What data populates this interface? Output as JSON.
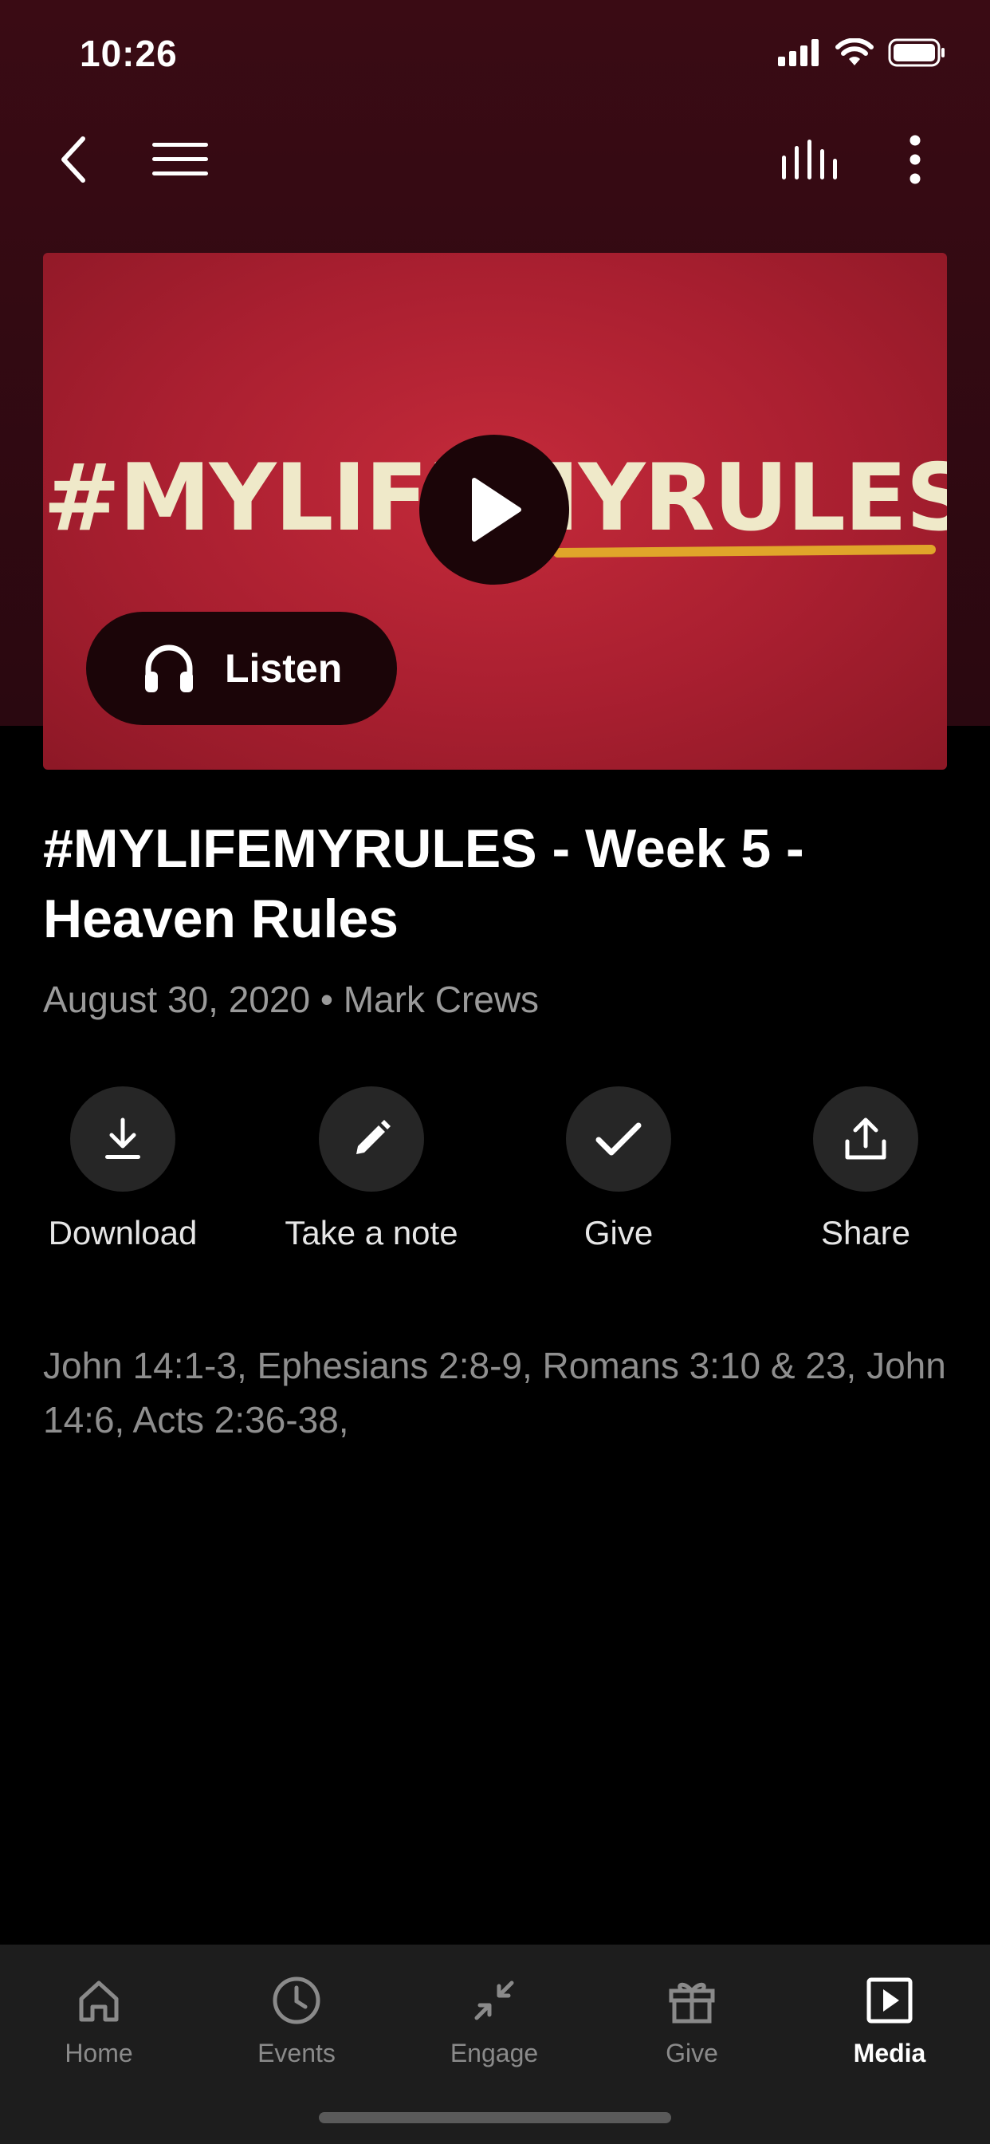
{
  "status_bar": {
    "time": "10:26"
  },
  "hero": {
    "artwork_text": "#MYLIFEMYRULES",
    "listen_label": "Listen"
  },
  "sermon": {
    "title": "#MYLIFEMYRULES - Week 5 - Heaven Rules",
    "meta": "August 30, 2020 • Mark Crews",
    "scripture": "John 14:1-3, Ephesians 2:8-9, Romans 3:10 & 23, John 14:6, Acts 2:36-38,"
  },
  "actions": [
    {
      "label": "Download",
      "icon": "download-icon"
    },
    {
      "label": "Take a note",
      "icon": "pencil-icon"
    },
    {
      "label": "Give",
      "icon": "checkmark-icon"
    },
    {
      "label": "Share",
      "icon": "share-icon"
    }
  ],
  "tabbar": {
    "tabs": [
      {
        "label": "Home",
        "icon": "home-icon"
      },
      {
        "label": "Events",
        "icon": "clock-icon"
      },
      {
        "label": "Engage",
        "icon": "engage-arrows-icon"
      },
      {
        "label": "Give",
        "icon": "gift-icon"
      },
      {
        "label": "Media",
        "icon": "play-square-icon",
        "active": true
      }
    ]
  },
  "colors": {
    "header_bg": "#3a0b14",
    "hero_red": "#b02232",
    "accent_yellow": "#e0a52a",
    "tabbar_bg": "#1d1d1d"
  }
}
